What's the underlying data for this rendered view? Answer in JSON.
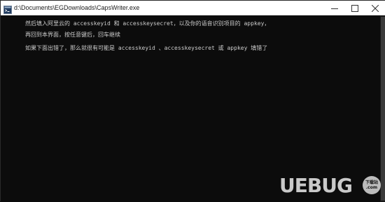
{
  "window": {
    "title": "d:\\Documents\\EGDownloads\\CapsWriter.exe",
    "icon": "console-app-icon"
  },
  "controls": {
    "minimize": "minimize-icon",
    "maximize": "maximize-icon",
    "close": "close-icon"
  },
  "console": {
    "lines": [
      "然后填入阿里云的 accesskeyid 和 accesskeysecret，以及你的语音识别项目的 appkey，",
      "再回到本界面，按任意键后，回车继续",
      "如果下面出错了，那么就很有可能是 accesskeyid 、accesskeysecret 或 appkey 填错了"
    ]
  },
  "watermark": {
    "brand": "UEBUG",
    "badge_line1": "下载站",
    "badge_line2": ".com"
  },
  "colors": {
    "console_bg": "#0c0c0c",
    "console_text": "#cccccc",
    "titlebar_bg": "#ffffff"
  }
}
